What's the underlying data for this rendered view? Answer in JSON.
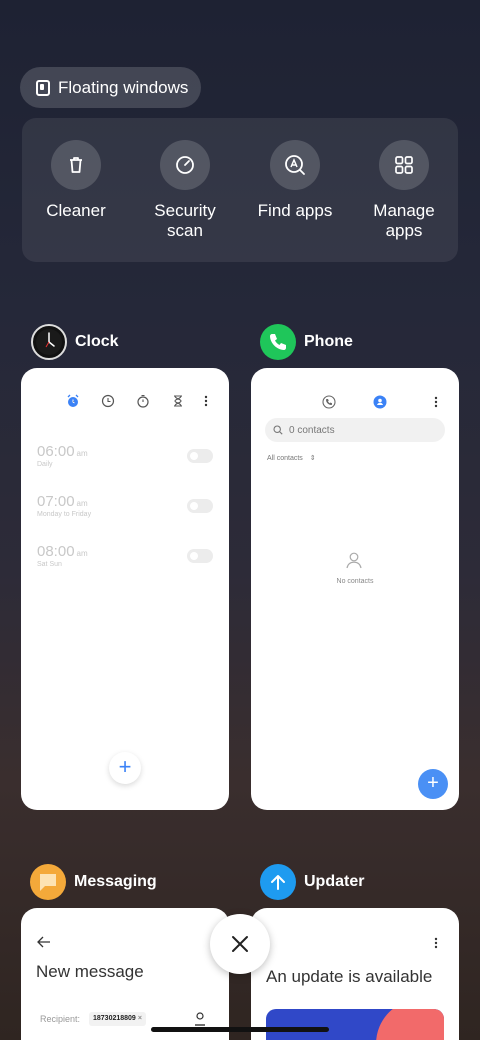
{
  "floating_windows": {
    "label": "Floating windows"
  },
  "tools": [
    {
      "label": "Cleaner",
      "icon": "trash-icon"
    },
    {
      "label": "Security\nscan",
      "icon": "security-scan-icon"
    },
    {
      "label": "Find apps",
      "icon": "find-apps-icon"
    },
    {
      "label": "Manage\napps",
      "icon": "grid-icon"
    }
  ],
  "apps": {
    "clock": {
      "name": "Clock",
      "alarms": [
        {
          "time": "06:00",
          "ampm": "am",
          "repeat": "Daily"
        },
        {
          "time": "07:00",
          "ampm": "am",
          "repeat": "Monday to Friday"
        },
        {
          "time": "08:00",
          "ampm": "am",
          "repeat": "Sat Sun"
        }
      ],
      "fab": "+"
    },
    "phone": {
      "name": "Phone",
      "search_placeholder": "0 contacts",
      "filter": "All contacts",
      "empty": "No contacts",
      "fab": "+"
    },
    "messaging": {
      "name": "Messaging",
      "title": "New message",
      "recipient_label": "Recipient:",
      "recipient_chip": "18730218809"
    },
    "updater": {
      "name": "Updater",
      "title": "An update is available"
    }
  },
  "colors": {
    "phone_green": "#1fc65a",
    "updater_blue": "#1e9bf0",
    "messaging_orange": "#f4a93a",
    "accent_blue": "#3b82f6"
  }
}
